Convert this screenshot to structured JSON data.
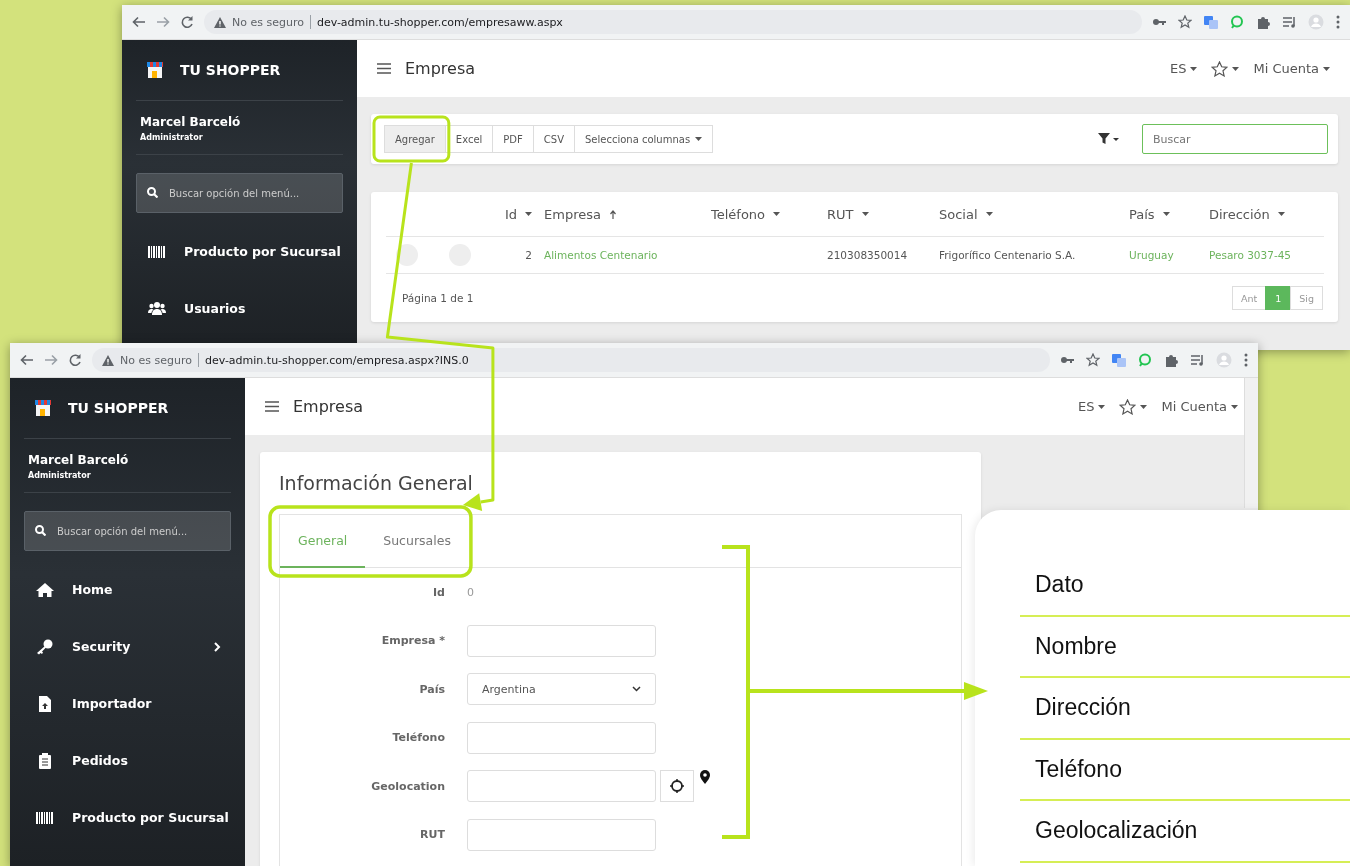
{
  "list_window": {
    "browser": {
      "security": "No es seguro",
      "url": "dev-admin.tu-shopper.com/empresaww.aspx"
    },
    "sidebar": {
      "brand": "TU SHOPPER",
      "user_name": "Marcel Barceló",
      "user_role": "Administrator",
      "search": {
        "placeholder": "Buscar opción del menú..."
      },
      "menu": [
        {
          "kind": "barcode",
          "label": "Producto por Sucursal",
          "submenu": false
        },
        {
          "kind": "users",
          "label": "Usuarios",
          "submenu": false
        }
      ]
    },
    "header": {
      "title": "Empresa",
      "language": "ES",
      "account": "Mi Cuenta"
    },
    "toolbar": {
      "buttons": [
        {
          "label": "Agregar",
          "kind": "plain"
        },
        {
          "label": "Excel",
          "kind": "plain"
        },
        {
          "label": "PDF",
          "kind": "plain"
        },
        {
          "label": "CSV",
          "kind": "plain"
        },
        {
          "label": "Selecciona columnas",
          "kind": "dropdown"
        }
      ],
      "search": {
        "placeholder": "Buscar"
      }
    },
    "table": {
      "columns": [
        {
          "label": "Id",
          "sorted": false
        },
        {
          "label": "Empresa",
          "sorted": true
        },
        {
          "label": "Teléfono",
          "sorted": false
        },
        {
          "label": "RUT",
          "sorted": false
        },
        {
          "label": "Social",
          "sorted": false
        },
        {
          "label": "País",
          "sorted": false
        },
        {
          "label": "Dirección",
          "sorted": false
        }
      ],
      "rows": [
        {
          "id": "2",
          "empresa": "Alimentos Centenario",
          "rut": "210308350014",
          "social": "Frigorífico Centenario S.A.",
          "pais": "Uruguay",
          "direccion": "Pesaro 3037-45"
        }
      ],
      "footer": "Página 1 de 1",
      "pages": [
        {
          "label": "Ant",
          "selected": false
        },
        {
          "label": "1",
          "selected": true
        },
        {
          "label": "Sig",
          "selected": false
        }
      ]
    }
  },
  "form_window": {
    "browser": {
      "security": "No es seguro",
      "url": "dev-admin.tu-shopper.com/empresa.aspx?INS.0"
    },
    "sidebar": {
      "brand": "TU SHOPPER",
      "user_name": "Marcel Barceló",
      "user_role": "Administrator",
      "search": {
        "placeholder": "Buscar opción del menú..."
      },
      "menu": [
        {
          "kind": "home",
          "label": "Home",
          "submenu": false
        },
        {
          "kind": "key",
          "label": "Security",
          "submenu": true
        },
        {
          "kind": "file",
          "label": "Importador",
          "submenu": false
        },
        {
          "kind": "clipboard",
          "label": "Pedidos",
          "submenu": false
        },
        {
          "kind": "barcode",
          "label": "Producto por Sucursal",
          "submenu": false
        }
      ]
    },
    "header": {
      "title": "Empresa",
      "language": "ES",
      "account": "Mi Cuenta"
    },
    "form": {
      "title": "Información General",
      "tabs": [
        {
          "label": "General",
          "selected": true
        },
        {
          "label": "Sucursales",
          "selected": false
        }
      ],
      "fields": [
        {
          "label": "Id",
          "kind": "static",
          "value": "0"
        },
        {
          "label": "Empresa *",
          "kind": "text"
        },
        {
          "label": "País",
          "kind": "select",
          "value": "Argentina"
        },
        {
          "label": "Teléfono",
          "kind": "text"
        },
        {
          "label": "Geolocation",
          "kind": "geo"
        },
        {
          "label": "RUT",
          "kind": "text"
        }
      ]
    }
  },
  "callout": {
    "items": [
      "Dato",
      "Nombre",
      "Dirección",
      "Teléfono",
      "Geolocalización"
    ]
  }
}
